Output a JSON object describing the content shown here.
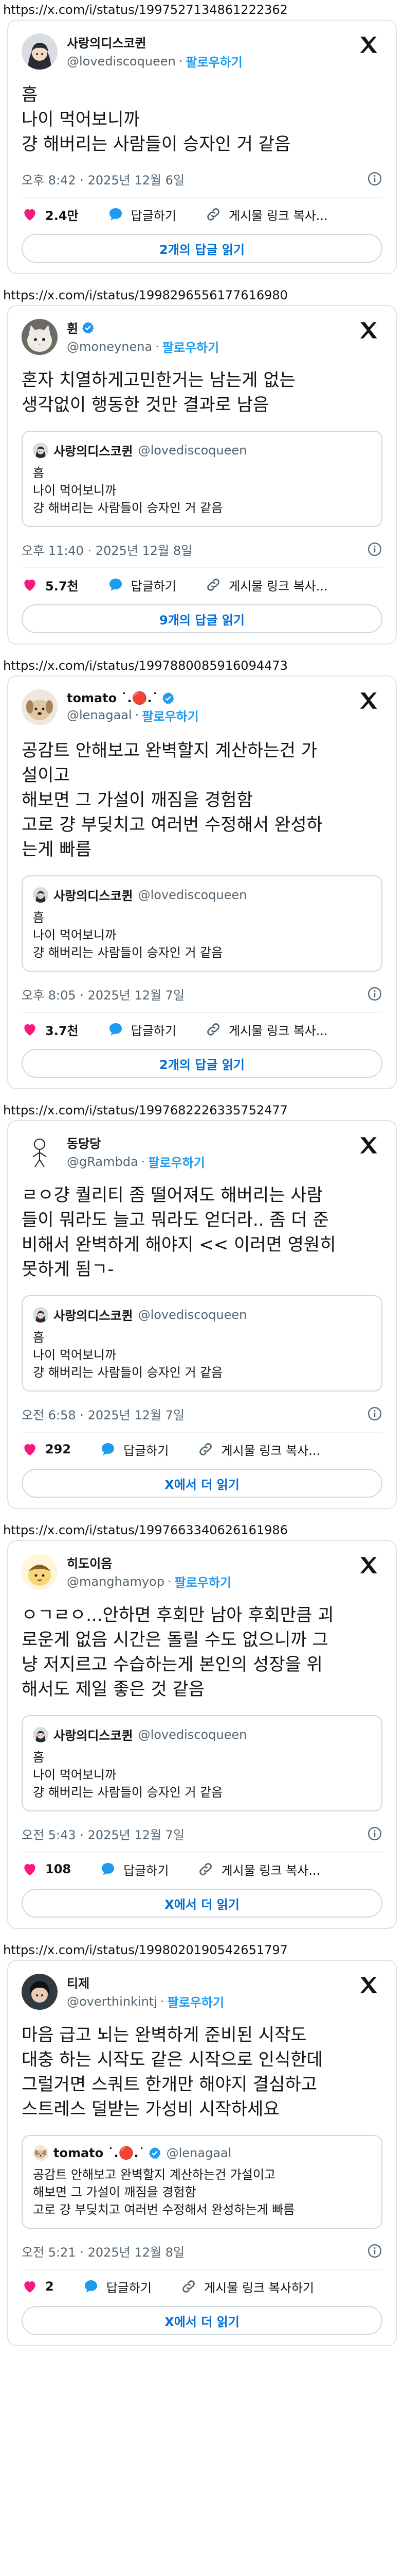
{
  "tweets": [
    {
      "url": "https://x.com/i/status/1997527134861222362",
      "name": "사랑의디스코퀸",
      "handle": "@lovediscoqueen",
      "follow": "팔로우하기",
      "verified": false,
      "text": "흠\n나이 먹어보니까\n걍 해버리는 사람들이 승자인 거 같음",
      "quote": null,
      "time": "오후 8:42 · 2025년 12월 6일",
      "likes": "2.4만",
      "reply_label": "답글하기",
      "copy_label": "게시물 링크 복사...",
      "read_label": "2개의 답글 읽기",
      "avatar_icon": "anime-girl-avatar"
    },
    {
      "url": "https://x.com/i/status/1998296556177616980",
      "name": "휜",
      "handle": "@moneynena",
      "follow": "팔로우하기",
      "verified": true,
      "text": "혼자 치열하게고민한거는 남는게 없는\n생각없이 행동한 것만 결과로 남음",
      "quote": {
        "name": "사랑의디스코퀸",
        "handle": "@lovediscoqueen",
        "text": "흠\n나이 먹어보니까\n걍 해버리는 사람들이 승자인 거 같음"
      },
      "time": "오후 11:40 · 2025년 12월 8일",
      "likes": "5.7천",
      "reply_label": "답글하기",
      "copy_label": "게시물 링크 복사...",
      "read_label": "9개의 답글 읽기",
      "avatar_icon": "cat-avatar"
    },
    {
      "url": "https://x.com/i/status/1997880085916094473",
      "name": "tomato ˙.🔴.˙",
      "handle": "@lenagaal",
      "follow": "팔로우하기",
      "verified": true,
      "text": "공감트 안해보고 완벽할지 계산하는건 가\n설이고\n해보면 그 가설이 깨짐을 경험함\n고로 걍 부딪치고 여러번 수정해서 완성하\n는게 빠름",
      "quote": {
        "name": "사랑의디스코퀸",
        "handle": "@lovediscoqueen",
        "text": "흠\n나이 먹어보니까\n걍 해버리는 사람들이 승자인 거 같음"
      },
      "time": "오후 8:05 · 2025년 12월 7일",
      "likes": "3.7천",
      "reply_label": "답글하기",
      "copy_label": "게시물 링크 복사...",
      "read_label": "2개의 답글 읽기",
      "avatar_icon": "dog-avatar"
    },
    {
      "url": "https://x.com/i/status/1997682226335752477",
      "name": "동당당",
      "handle": "@gRambda",
      "follow": "팔로우하기",
      "verified": false,
      "text": "ㄹㅇ걍 퀄리티 좀 떨어져도 해버리는 사람\n들이 뭐라도 늘고 뭐라도 얻더라.. 좀 더 준\n비해서 완벽하게 해야지 << 이러면 영원히\n못하게 됨ㄱ-",
      "quote": {
        "name": "사랑의디스코퀸",
        "handle": "@lovediscoqueen",
        "text": "흠\n나이 먹어보니까\n걍 해버리는 사람들이 승자인 거 같음"
      },
      "time": "오전 6:58 · 2025년 12월 7일",
      "likes": "292",
      "reply_label": "답글하기",
      "copy_label": "게시물 링크 복사...",
      "read_label": "X에서 더 읽기",
      "avatar_icon": "stick-figure-avatar"
    },
    {
      "url": "https://x.com/i/status/1997663340626161986",
      "name": "히도이음",
      "handle": "@manghamyop",
      "follow": "팔로우하기",
      "verified": false,
      "text": "ㅇㄱㄹㅇ...안하면 후회만 남아 후회만큼 괴\n로운게 없음 시간은 돌릴 수도 없으니까 그\n냥 저지르고 수습하는게 본인의 성장을 위\n해서도 제일 좋은 것 같음",
      "quote": {
        "name": "사랑의디스코퀸",
        "handle": "@lovediscoqueen",
        "text": "흠\n나이 먹어보니까\n걍 해버리는 사람들이 승자인 거 같음"
      },
      "time": "오전 5:43 · 2025년 12월 7일",
      "likes": "108",
      "reply_label": "답글하기",
      "copy_label": "게시물 링크 복사...",
      "read_label": "X에서 더 읽기",
      "avatar_icon": "pudding-avatar"
    },
    {
      "url": "https://x.com/i/status/1998020190542651797",
      "name": "티제",
      "handle": "@overthinkintj",
      "follow": "팔로우하기",
      "verified": false,
      "text": "마음 급고 뇌는 완벽하게 준비된 시작도\n대충 하는 시작도 같은 시작으로 인식한데\n그럴거면 스쿼트 한개만 해야지 결심하고\n스트레스 덜받는 가성비 시작하세요",
      "quote": {
        "name": "tomato ˙.🔴.˙",
        "handle": "@lenagaal",
        "text": "공감트 안해보고 완벽할지 계산하는건 가설이고\n해보면 그 가설이 깨짐을 경험함\n고로 걍 부딪치고 여러번 수정해서 완성하는게 빠름"
      },
      "time": "오전 5:21 · 2025년 12월 8일",
      "likes": "2",
      "reply_label": "답글하기",
      "copy_label": "게시물 링크 복사하기",
      "read_label": "X에서 더 읽기",
      "avatar_icon": "dark-hair-avatar"
    }
  ],
  "colors": {
    "accent": "#1d9bf0",
    "link_button": "#006fd6",
    "heart": "#f91880",
    "muted": "#536471"
  }
}
